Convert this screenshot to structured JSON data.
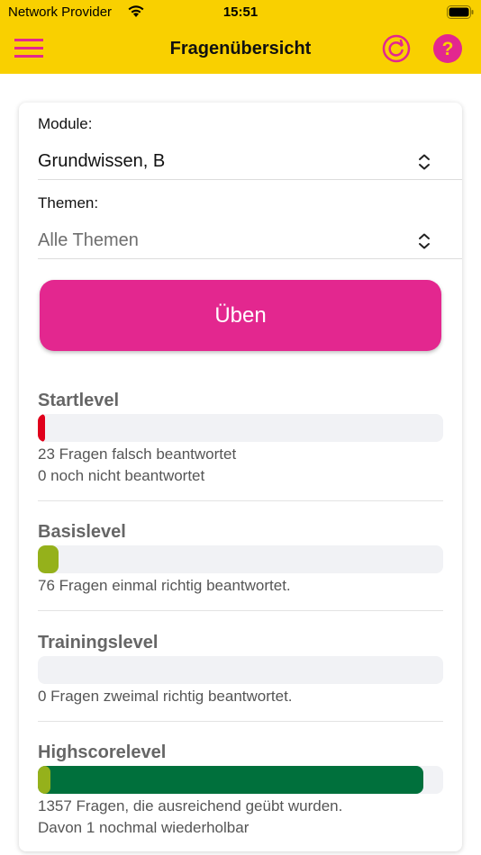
{
  "status_bar": {
    "carrier": "Network Provider",
    "time": "15:51"
  },
  "header": {
    "title": "Fragenübersicht",
    "icons": {
      "menu": "hamburger-menu-icon",
      "refresh": "refresh-icon",
      "help": "help-question-icon"
    }
  },
  "form": {
    "module_label": "Module:",
    "module_value": "Grundwissen, B",
    "themes_label": "Themen:",
    "themes_value": "Alle Themen",
    "practice_button": "Üben"
  },
  "levels": [
    {
      "title": "Startlevel",
      "lines": [
        "23 Fragen falsch beantwortet",
        "0 noch nicht beantwortet"
      ],
      "segments": [
        {
          "color": "#e0001b",
          "fraction": 0.016
        }
      ]
    },
    {
      "title": "Basislevel",
      "lines": [
        "76 Fragen einmal richtig beantwortet."
      ],
      "segments": [
        {
          "color": "#95b11b",
          "fraction": 0.052
        }
      ]
    },
    {
      "title": "Trainingslevel",
      "lines": [
        "0 Fragen zweimal richtig beantwortet."
      ],
      "segments": []
    },
    {
      "title": "Highscorelevel",
      "lines": [
        "1357 Fragen, die ausreichend geübt wurden.",
        "Davon 1 nochmal wiederholbar"
      ],
      "segments": [
        {
          "color": "#95b11b",
          "fraction": 0.03
        },
        {
          "color": "#00703c",
          "fraction": 0.95
        }
      ]
    }
  ],
  "colors": {
    "header_bg": "#f9d000",
    "accent_pink": "#e3278f",
    "card_bg": "#ffffff"
  }
}
